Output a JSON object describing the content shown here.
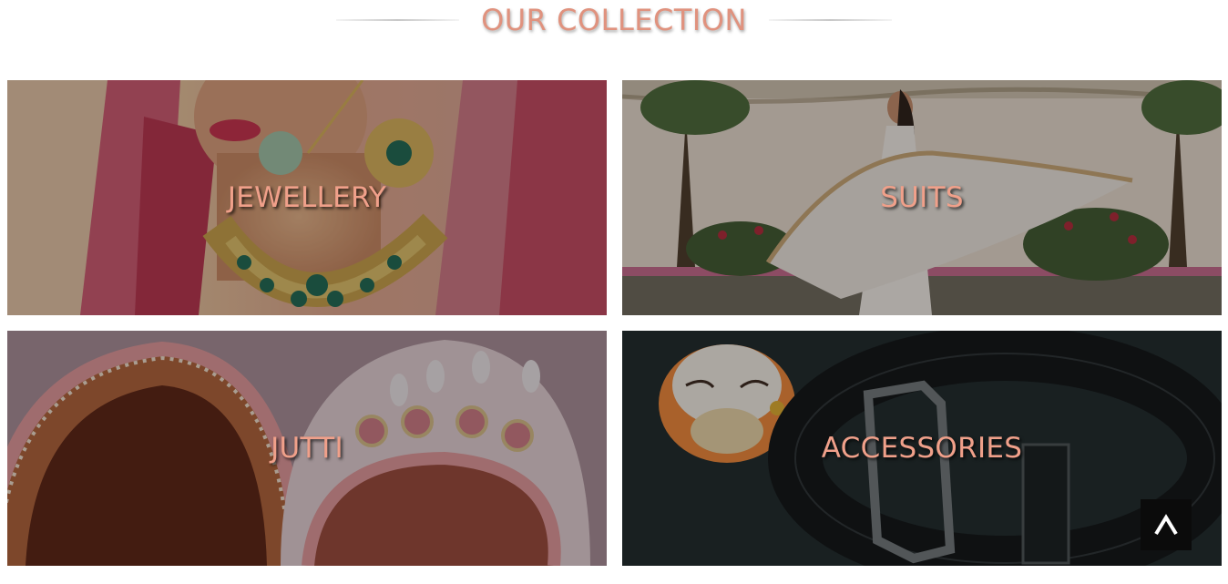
{
  "section": {
    "title": "OUR COLLECTION",
    "accent_color": "#e0927e"
  },
  "collections": [
    {
      "label": "JEWELLERY",
      "image": "bridal-jewellery-photo"
    },
    {
      "label": "SUITS",
      "image": "woman-in-white-suit-photo"
    },
    {
      "label": "JUTTI",
      "image": "embroidered-jutti-photo"
    },
    {
      "label": "ACCESSORIES",
      "image": "belt-and-lucky-cat-photo"
    }
  ],
  "back_to_top": {
    "icon": "caret-up-icon",
    "glyph": "^"
  }
}
